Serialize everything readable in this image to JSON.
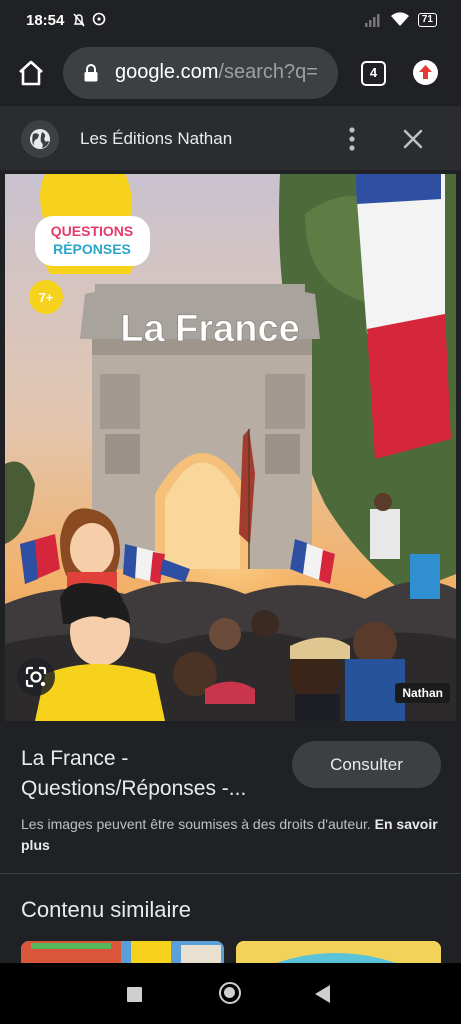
{
  "status_bar": {
    "time": "18:54",
    "battery": "71"
  },
  "browser": {
    "url_domain": "google.com",
    "url_path": "/search?q=",
    "tab_count": "4"
  },
  "sheet": {
    "site_name": "Les Éditions Nathan",
    "title": "La France - Questions/Réponses -...",
    "consult_label": "Consulter",
    "copyright_text": "Les images peuvent être soumises à des droits d'auteur.",
    "learn_more": "En savoir plus",
    "similar_heading": "Contenu similaire"
  },
  "cover": {
    "series_line1": "QUESTIONS",
    "series_line2": "RÉPONSES",
    "age": "7+",
    "book_title": "La France",
    "publisher": "Nathan"
  },
  "colors": {
    "background": "#202124",
    "button": "#3c4043",
    "flag_blue": "#2f4fa2",
    "flag_red": "#d6263b",
    "accent_yellow": "#f7d21c"
  },
  "icons": {
    "home": "home-icon",
    "lock": "lock-icon",
    "tabs": "tab-switcher-icon",
    "update": "update-arrow-icon",
    "globe": "globe-icon",
    "more": "more-vert-icon",
    "close": "close-icon",
    "lens": "google-lens-icon"
  }
}
